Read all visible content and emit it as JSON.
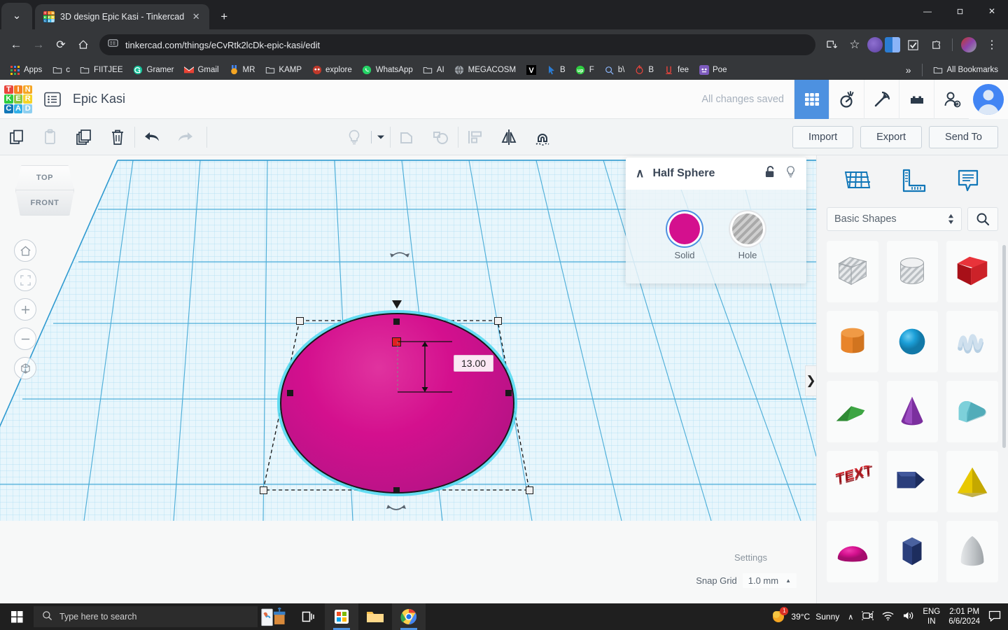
{
  "browser": {
    "tab": {
      "title": "3D design Epic Kasi - Tinkercad",
      "favicon_letters": [
        "T",
        "I",
        "N",
        "K",
        "E",
        "R",
        "C",
        "A",
        "D"
      ],
      "close_glyph": "✕",
      "chevron_glyph": "⌄"
    },
    "newtab_glyph": "+",
    "window_controls": {
      "minimize": "—",
      "restore": "❐",
      "close": "✕"
    },
    "nav": {
      "back": "←",
      "forward": "→",
      "reload": "⟳",
      "home": "⌂"
    },
    "url": "tinkercad.com/things/eCvRtk2lcDk-epic-kasi/edit",
    "omnibox_icons": {
      "site_settings": "site-settings-icon",
      "install": "install-icon",
      "bookmark": "☆"
    },
    "extensions": [
      "extension-purple-icon",
      "extension-blue-icon",
      "extension-check-icon",
      "extension-puzzle-icon"
    ],
    "menu_glyph": "⋮"
  },
  "bookmarks": {
    "items": [
      {
        "label": "Apps",
        "icon": "apps-grid-icon",
        "color": "#d94a3e"
      },
      {
        "label": "c",
        "icon": "folder-icon",
        "color": "#c8ccd0"
      },
      {
        "label": "FIITJEE",
        "icon": "folder-icon",
        "color": "#c8ccd0"
      },
      {
        "label": "Gramer",
        "icon": "grammarly-icon",
        "color": "#15c39a"
      },
      {
        "label": "Gmail",
        "icon": "gmail-icon",
        "color": "#ea4335"
      },
      {
        "label": "MR",
        "icon": "medal-icon",
        "color": "#f5a623"
      },
      {
        "label": "KAMP",
        "icon": "folder-icon",
        "color": "#c8ccd0"
      },
      {
        "label": "explore",
        "icon": "explore-icon",
        "color": "#c0392b"
      },
      {
        "label": "WhatsApp",
        "icon": "whatsapp-icon",
        "color": "#25d366"
      },
      {
        "label": "AI",
        "icon": "folder-icon",
        "color": "#c8ccd0"
      },
      {
        "label": "MEGACOSM",
        "icon": "globe-icon",
        "color": "#9aa0a6"
      },
      {
        "label": "",
        "icon": "v-letter-icon",
        "color": "#ffffff"
      },
      {
        "label": "B",
        "icon": "cursor-icon",
        "color": "#2b7cd3"
      },
      {
        "label": "F",
        "icon": "up-circle-icon",
        "color": "#2ecc40"
      },
      {
        "label": "b\\",
        "icon": "search-icon",
        "color": "#8ab4f8"
      },
      {
        "label": "B",
        "icon": "flame-icon",
        "color": "#e8453c"
      },
      {
        "label": "fee",
        "icon": "squiggle-icon",
        "color": "#e8453c"
      },
      {
        "label": "Poe",
        "icon": "poe-icon",
        "color": "#7d5bbe"
      }
    ],
    "overflow_glyph": "»",
    "all_bookmarks": "All Bookmarks"
  },
  "tinkercad": {
    "logo_cells": [
      {
        "letter": "T",
        "color": "#e8453c"
      },
      {
        "letter": "I",
        "color": "#f58220"
      },
      {
        "letter": "N",
        "color": "#f5a623"
      },
      {
        "letter": "K",
        "color": "#2ecc40"
      },
      {
        "letter": "E",
        "color": "#8cc63f"
      },
      {
        "letter": "R",
        "color": "#f5d328"
      },
      {
        "letter": "C",
        "color": "#1277b8"
      },
      {
        "letter": "A",
        "color": "#32b0e8"
      },
      {
        "letter": "D",
        "color": "#8ecff0"
      }
    ],
    "project_title": "Epic Kasi",
    "save_status": "All changes saved",
    "header_buttons": [
      {
        "name": "grid-view-button",
        "icon": "grid-icon",
        "active": true
      },
      {
        "name": "codeblocks-button",
        "icon": "codeblocks-icon",
        "active": false
      },
      {
        "name": "minecraft-button",
        "icon": "pickaxe-icon",
        "active": false
      },
      {
        "name": "blocks-button",
        "icon": "lego-brick-icon",
        "active": false
      },
      {
        "name": "invite-button",
        "icon": "add-person-icon",
        "active": false
      }
    ],
    "toolbar": {
      "left_tools": [
        {
          "name": "copy-button",
          "icon": "copy-icon",
          "dim": false
        },
        {
          "name": "paste-button",
          "icon": "paste-icon",
          "dim": true
        },
        {
          "name": "duplicate-button",
          "icon": "duplicate-icon",
          "dim": false
        },
        {
          "name": "delete-button",
          "icon": "trash-icon",
          "dim": false
        },
        {
          "name": "undo-button",
          "icon": "undo-arrow-icon",
          "dim": false
        },
        {
          "name": "redo-button",
          "icon": "redo-arrow-icon",
          "dim": true
        }
      ],
      "right_tools": [
        {
          "name": "light-button",
          "icon": "lightbulb-icon",
          "dim": true
        },
        {
          "name": "group-button",
          "icon": "group-icon",
          "dim": true
        },
        {
          "name": "ungroup-button",
          "icon": "ungroup-icon",
          "dim": true
        },
        {
          "name": "align-button",
          "icon": "align-icon",
          "dim": true
        },
        {
          "name": "mirror-button",
          "icon": "mirror-icon",
          "dim": false
        },
        {
          "name": "magnet-button",
          "icon": "magnet-icon",
          "dim": false
        }
      ],
      "import_label": "Import",
      "export_label": "Export",
      "sendto_label": "Send To"
    },
    "inspector": {
      "title": "Half Sphere",
      "collapse_glyph": "∧",
      "lock_icon": "unlock-icon",
      "light_icon": "lightbulb-icon",
      "solid_label": "Solid",
      "hole_label": "Hole",
      "solid_color": "#d4108e"
    },
    "viewcube": {
      "top_label": "TOP",
      "front_label": "FRONT"
    },
    "nav_buttons": [
      {
        "name": "home-view-button",
        "icon": "home-icon",
        "glyph": "⌂",
        "dim": false
      },
      {
        "name": "fit-view-button",
        "icon": "fit-to-view-icon",
        "glyph": "⬚",
        "dim": true
      },
      {
        "name": "zoom-in-button",
        "icon": "plus-icon",
        "glyph": "+",
        "dim": false
      },
      {
        "name": "zoom-out-button",
        "icon": "minus-icon",
        "glyph": "−",
        "dim": false
      },
      {
        "name": "perspective-button",
        "icon": "cube-view-icon",
        "glyph": "⬢",
        "dim": false
      }
    ],
    "canvas": {
      "dimension_value": "13.00",
      "settings_label": "Settings",
      "snapgrid_label": "Snap Grid",
      "snapgrid_value": "1.0 mm",
      "snapgrid_caret": "▲",
      "panel_toggle_glyph": "❯",
      "shape_color": "#d4108e",
      "selection_color": "#4dd8f0"
    },
    "sidebar": {
      "tools": [
        {
          "name": "workplane-tool",
          "icon": "workplane-grid-icon"
        },
        {
          "name": "ruler-tool",
          "icon": "ruler-icon"
        },
        {
          "name": "notes-tool",
          "icon": "note-bubble-icon"
        }
      ],
      "category": "Basic Shapes",
      "search_icon": "search-icon",
      "shapes": [
        {
          "name": "box-hole",
          "label": "Box Hole",
          "color": "#c7cbce",
          "kind": "hole-cube"
        },
        {
          "name": "cylinder-hole",
          "label": "Cylinder Hole",
          "color": "#c7cbce",
          "kind": "hole-cylinder"
        },
        {
          "name": "box",
          "label": "Box",
          "color": "#cc2229",
          "kind": "cube"
        },
        {
          "name": "cylinder",
          "label": "Cylinder",
          "color": "#e8842a",
          "kind": "cylinder"
        },
        {
          "name": "sphere",
          "label": "Sphere",
          "color": "#1b9fd8",
          "kind": "sphere"
        },
        {
          "name": "scribble",
          "label": "Scribble",
          "color": "#b6cfe3",
          "kind": "scribble"
        },
        {
          "name": "wedge",
          "label": "Wedge",
          "color": "#3da543",
          "kind": "wedge"
        },
        {
          "name": "cone",
          "label": "Cone",
          "color": "#7b2f9e",
          "kind": "cone"
        },
        {
          "name": "roof",
          "label": "Roof",
          "color": "#5ab6c4",
          "kind": "roof"
        },
        {
          "name": "text",
          "label": "TEXT",
          "color": "#cc2229",
          "kind": "text"
        },
        {
          "name": "arrow",
          "label": "Arrow",
          "color": "#2b3f7c",
          "kind": "arrow"
        },
        {
          "name": "pyramid",
          "label": "Pyramid",
          "color": "#e8c800",
          "kind": "pyramid"
        },
        {
          "name": "half-sphere",
          "label": "Half Sphere",
          "color": "#d4108e",
          "kind": "half-sphere"
        },
        {
          "name": "polygon",
          "label": "Polygon",
          "color": "#2b3f7c",
          "kind": "polygon"
        },
        {
          "name": "paraboloid",
          "label": "Paraboloid",
          "color": "#bfc3c6",
          "kind": "paraboloid"
        }
      ]
    }
  },
  "taskbar": {
    "start_icon": "windows-start-icon",
    "search_placeholder": "Type here to search",
    "search_icon": "search-icon",
    "apps": [
      {
        "name": "task-view-button",
        "icon": "task-view-icon",
        "active": false
      },
      {
        "name": "microsoft-store-button",
        "icon": "store-icon",
        "active": true
      },
      {
        "name": "file-explorer-button",
        "icon": "file-explorer-icon",
        "active": false
      },
      {
        "name": "chrome-button",
        "icon": "chrome-icon",
        "active": true
      }
    ],
    "weather_temp": "39°C",
    "weather_desc": "Sunny",
    "weather_badge": "1",
    "tray_chevron": "∧",
    "tray_icons": [
      "camera-icon",
      "wifi-icon",
      "speaker-icon"
    ],
    "lang_line1": "ENG",
    "lang_line2": "IN",
    "time": "2:01 PM",
    "date": "6/6/2024",
    "notification_icon": "notification-icon"
  }
}
